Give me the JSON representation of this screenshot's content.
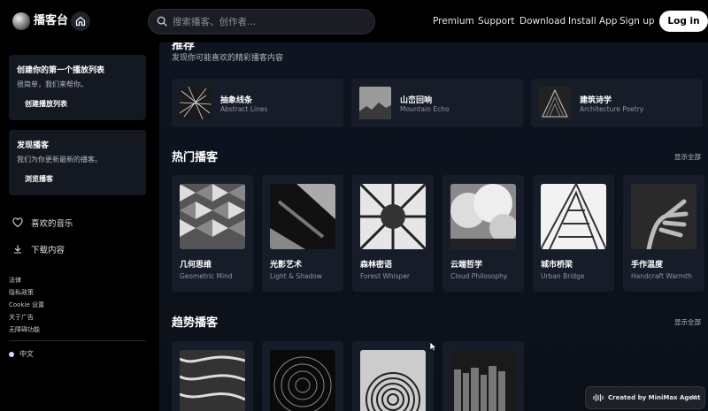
{
  "header": {
    "brand": "播客台",
    "search_placeholder": "搜索播客、创作者...",
    "nav": [
      "Premium",
      "Support",
      "Download",
      "Install App",
      "Sign up"
    ],
    "login_label": "Log in"
  },
  "sidebar": {
    "cards": [
      {
        "title": "创建你的第一个播放列表",
        "desc": "很简单，我们来帮你。",
        "button": "创建播放列表"
      },
      {
        "title": "发现播客",
        "desc": "我们为你更新最新的播客。",
        "button": "浏览播客"
      }
    ],
    "items": [
      {
        "label": "喜欢的音乐",
        "icon": "heart-icon"
      },
      {
        "label": "下载内容",
        "icon": "download-icon"
      }
    ],
    "legal": [
      "法律",
      "隐私政策",
      "Cookie 设置",
      "关于广告",
      "无障碍功能"
    ],
    "language": "中文"
  },
  "main": {
    "section0_title": "推荐",
    "section0_subtitle": "发现你可能喜欢的精彩播客内容",
    "recommended": [
      {
        "title": "抽象线条",
        "subtitle": "Abstract Lines"
      },
      {
        "title": "山峦回响",
        "subtitle": "Mountain Echo"
      },
      {
        "title": "建筑诗学",
        "subtitle": "Architecture Poetry"
      }
    ],
    "hot_title": "热门播客",
    "show_all": "显示全部",
    "hot": [
      {
        "title": "几何思维",
        "subtitle": "Geometric Mind"
      },
      {
        "title": "光影艺术",
        "subtitle": "Light & Shadow"
      },
      {
        "title": "森林密语",
        "subtitle": "Forest Whisper"
      },
      {
        "title": "云端哲学",
        "subtitle": "Cloud Philosophy"
      },
      {
        "title": "城市桥梁",
        "subtitle": "Urban Bridge"
      },
      {
        "title": "手作温度",
        "subtitle": "Handcraft Warmth"
      }
    ],
    "trending_title": "趋势播客"
  },
  "badge": {
    "label": "Created by MiniMax Agent",
    "close": "×"
  }
}
